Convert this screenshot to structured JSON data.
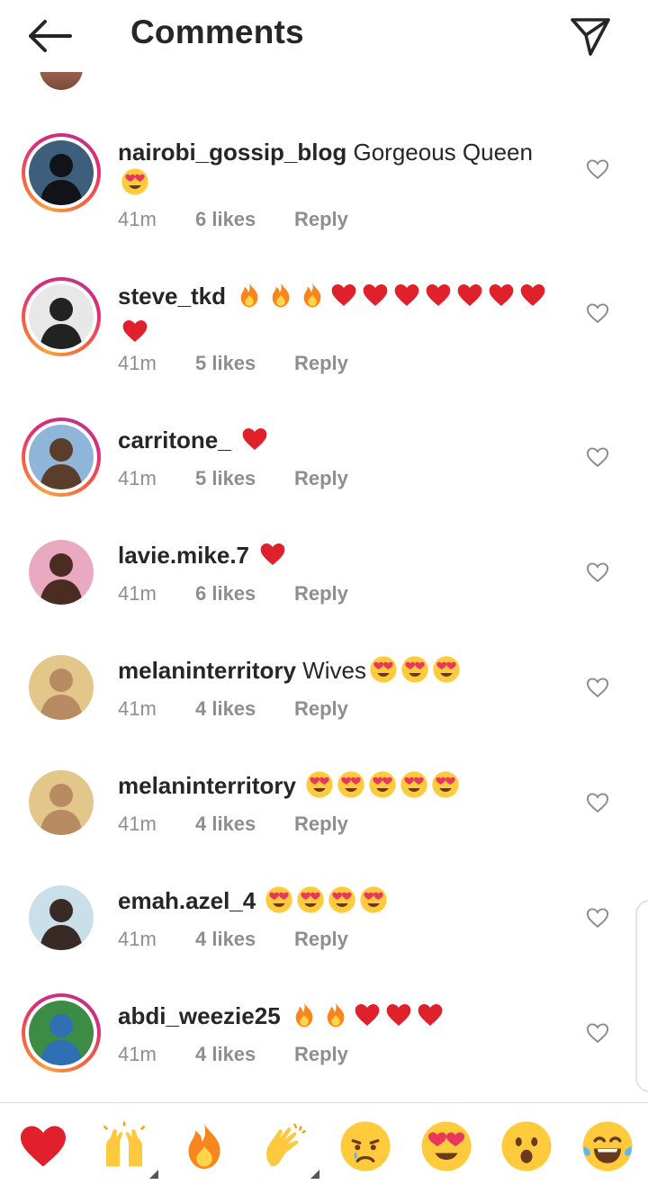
{
  "header": {
    "title": "Comments",
    "back_icon": "arrow-left-icon",
    "send_icon": "paper-plane-icon"
  },
  "comments": [
    {
      "username": "nairobi_gossip_blog",
      "text": " Gorgeous Queen",
      "emojis": "😍",
      "time": "41m",
      "likes": "6 likes",
      "reply": "Reply",
      "story_ring": true,
      "avatar_colors": [
        "#3d5f7c",
        "#111318"
      ]
    },
    {
      "username": "steve_tkd",
      "text": " ",
      "emojis": "🔥🔥🔥❤️❤️❤️❤️❤️❤️❤️❤️",
      "time": "41m",
      "likes": "5 likes",
      "reply": "Reply",
      "story_ring": true,
      "avatar_colors": [
        "#e8e8e8",
        "#222222"
      ]
    },
    {
      "username": "carritone_",
      "text": " ",
      "emojis": "❤️",
      "time": "41m",
      "likes": "5 likes",
      "reply": "Reply",
      "story_ring": true,
      "avatar_colors": [
        "#8fb5d8",
        "#5b3d2b"
      ]
    },
    {
      "username": "lavie.mike.7",
      "text": " ",
      "emojis": "❤️",
      "time": "41m",
      "likes": "6 likes",
      "reply": "Reply",
      "story_ring": false,
      "avatar_colors": [
        "#e9a9c0",
        "#4a2c22"
      ]
    },
    {
      "username": "melaninterritory",
      "text": " Wives",
      "emojis": "😍😍😍",
      "time": "41m",
      "likes": "4 likes",
      "reply": "Reply",
      "story_ring": false,
      "avatar_colors": [
        "#e3c68a",
        "#b98b62"
      ]
    },
    {
      "username": "melaninterritory",
      "text": " ",
      "emojis": "😍😍😍😍😍",
      "time": "41m",
      "likes": "4 likes",
      "reply": "Reply",
      "story_ring": false,
      "avatar_colors": [
        "#e3c68a",
        "#b98b62"
      ]
    },
    {
      "username": "emah.azel_4",
      "text": " ",
      "emojis": "😍😍😍😍",
      "time": "41m",
      "likes": "4 likes",
      "reply": "Reply",
      "story_ring": false,
      "avatar_colors": [
        "#c9e0ea",
        "#3a2a25"
      ]
    },
    {
      "username": "abdi_weezie25",
      "text": " ",
      "emojis": "🔥🔥❤️❤️❤️",
      "time": "41m",
      "likes": "4 likes",
      "reply": "Reply",
      "story_ring": true,
      "avatar_colors": [
        "#3d8c46",
        "#2f6fb3"
      ]
    }
  ],
  "emoji_bar": [
    {
      "name": "heart",
      "glyph": "❤️"
    },
    {
      "name": "raising-hands",
      "glyph": "🙌"
    },
    {
      "name": "fire",
      "glyph": "🔥"
    },
    {
      "name": "clapping-hands",
      "glyph": "👏"
    },
    {
      "name": "crying-face",
      "glyph": "😢"
    },
    {
      "name": "heart-eyes",
      "glyph": "😍"
    },
    {
      "name": "surprised-face",
      "glyph": "😮"
    },
    {
      "name": "tears-of-joy",
      "glyph": "😂"
    }
  ],
  "colors": {
    "text": "#262626",
    "meta": "#8e8e8e",
    "heart_red": "#e0202a",
    "divider": "#dbdbdb"
  }
}
